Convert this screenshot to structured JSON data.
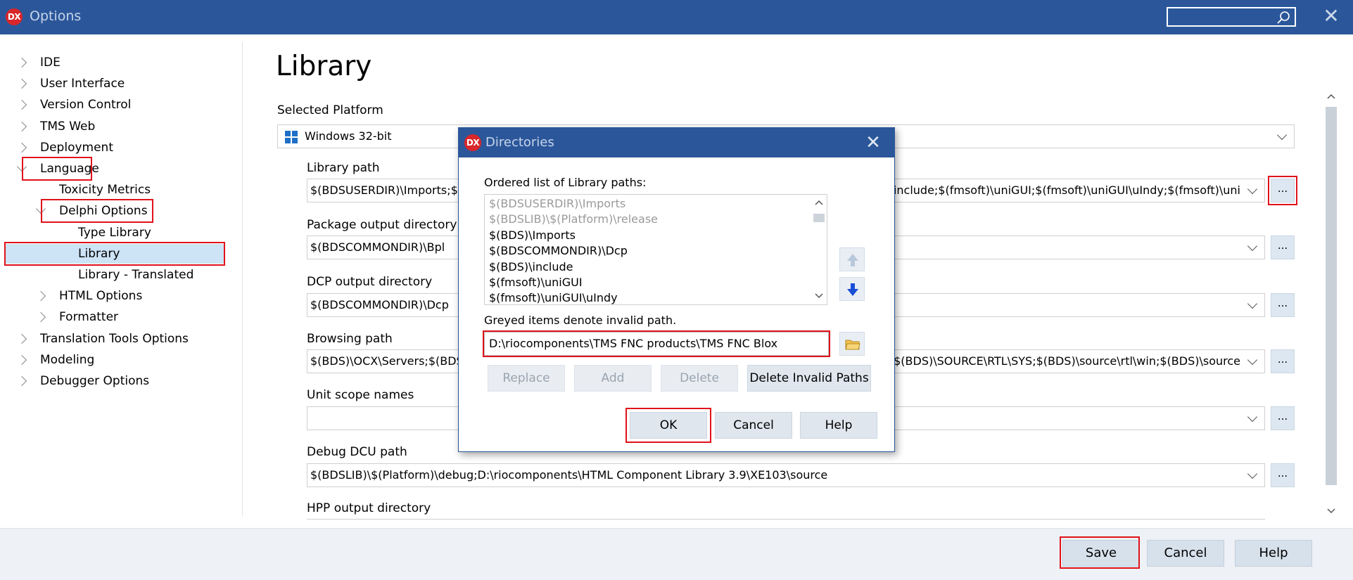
{
  "window": {
    "logo_text": "DX",
    "title": "Options",
    "close_glyph": "✕"
  },
  "tree": {
    "items": [
      {
        "label": "IDE",
        "level": 0,
        "expander": "collapsed"
      },
      {
        "label": "User Interface",
        "level": 0,
        "expander": "collapsed"
      },
      {
        "label": "Version Control",
        "level": 0,
        "expander": "collapsed"
      },
      {
        "label": "TMS Web",
        "level": 0,
        "expander": "collapsed"
      },
      {
        "label": "Deployment",
        "level": 0,
        "expander": "collapsed"
      },
      {
        "label": "Language",
        "level": 0,
        "expander": "expanded",
        "highlighted": true
      },
      {
        "label": "Toxicity Metrics",
        "level": 1,
        "expander": "none"
      },
      {
        "label": "Delphi Options",
        "level": 1,
        "expander": "expanded",
        "highlighted": true
      },
      {
        "label": "Type Library",
        "level": 2,
        "expander": "none"
      },
      {
        "label": "Library",
        "level": 2,
        "expander": "none",
        "selected": true,
        "highlighted": true
      },
      {
        "label": "Library - Translated",
        "level": 2,
        "expander": "none"
      },
      {
        "label": "HTML Options",
        "level": 1,
        "expander": "collapsed"
      },
      {
        "label": "Formatter",
        "level": 1,
        "expander": "collapsed"
      },
      {
        "label": "Translation Tools Options",
        "level": 0,
        "expander": "collapsed"
      },
      {
        "label": "Modeling",
        "level": 0,
        "expander": "collapsed"
      },
      {
        "label": "Debugger Options",
        "level": 0,
        "expander": "collapsed"
      }
    ]
  },
  "main": {
    "title": "Library",
    "selected_platform_label": "Selected Platform",
    "platform_value": "Windows 32-bit",
    "fields": {
      "library_path": {
        "label": "Library path",
        "left_value": "$(BDSUSERDIR)\\Imports;$(",
        "right_value": "include;$(fmsoft)\\uniGUI;$(fmsoft)\\uniGUI\\uIndy;$(fmsoft)\\uni"
      },
      "package_output": {
        "label": "Package output directory",
        "left_value": "$(BDSCOMMONDIR)\\Bpl",
        "right_value": ""
      },
      "dcp_output": {
        "label": "DCP output directory",
        "left_value": "$(BDSCOMMONDIR)\\Dcp",
        "right_value": ""
      },
      "browsing_path": {
        "label": "Browsing path",
        "left_value": "$(BDS)\\OCX\\Servers;$(BDS",
        "right_value": ";$(BDS)\\SOURCE\\RTL\\SYS;$(BDS)\\source\\rtl\\win;$(BDS)\\source"
      },
      "unit_scope": {
        "label": "Unit scope names",
        "left_value": "",
        "right_value": ""
      },
      "debug_dcu": {
        "label": "Debug DCU path",
        "left_value": "$(BDSLIB)\\$(Platform)\\debug;D:\\riocomponents\\HTML Component Library 3.9\\XE103\\source",
        "right_value": ""
      },
      "hpp_output": {
        "label": "HPP output directory"
      }
    },
    "dots_label": "..."
  },
  "footer": {
    "save": "Save",
    "cancel": "Cancel",
    "help": "Help"
  },
  "dialog": {
    "logo_text": "DX",
    "title": "Directories",
    "close_glyph": "✕",
    "list_label": "Ordered list of Library paths:",
    "list_items": [
      {
        "text": "$(BDSUSERDIR)\\Imports",
        "invalid": true
      },
      {
        "text": "$(BDSLIB)\\$(Platform)\\release",
        "invalid": true
      },
      {
        "text": "$(BDS)\\Imports",
        "invalid": false
      },
      {
        "text": "$(BDSCOMMONDIR)\\Dcp",
        "invalid": false
      },
      {
        "text": "$(BDS)\\include",
        "invalid": false
      },
      {
        "text": "$(fmsoft)\\uniGUI",
        "invalid": false
      },
      {
        "text": "$(fmsoft)\\uniGUI\\uIndy",
        "invalid": false
      }
    ],
    "greyed_note": "Greyed items denote invalid path.",
    "path_value": "D:\\riocomponents\\TMS FNC products\\TMS FNC Blox",
    "buttons": {
      "replace": "Replace",
      "add": "Add",
      "delete": "Delete",
      "delete_invalid": "Delete Invalid Paths",
      "ok": "OK",
      "cancel": "Cancel",
      "help": "Help"
    }
  },
  "colors": {
    "titlebar": "#2b579a",
    "highlight_box": "#e0121b",
    "selection": "#cde4f7",
    "button": "#d7e1ec"
  }
}
